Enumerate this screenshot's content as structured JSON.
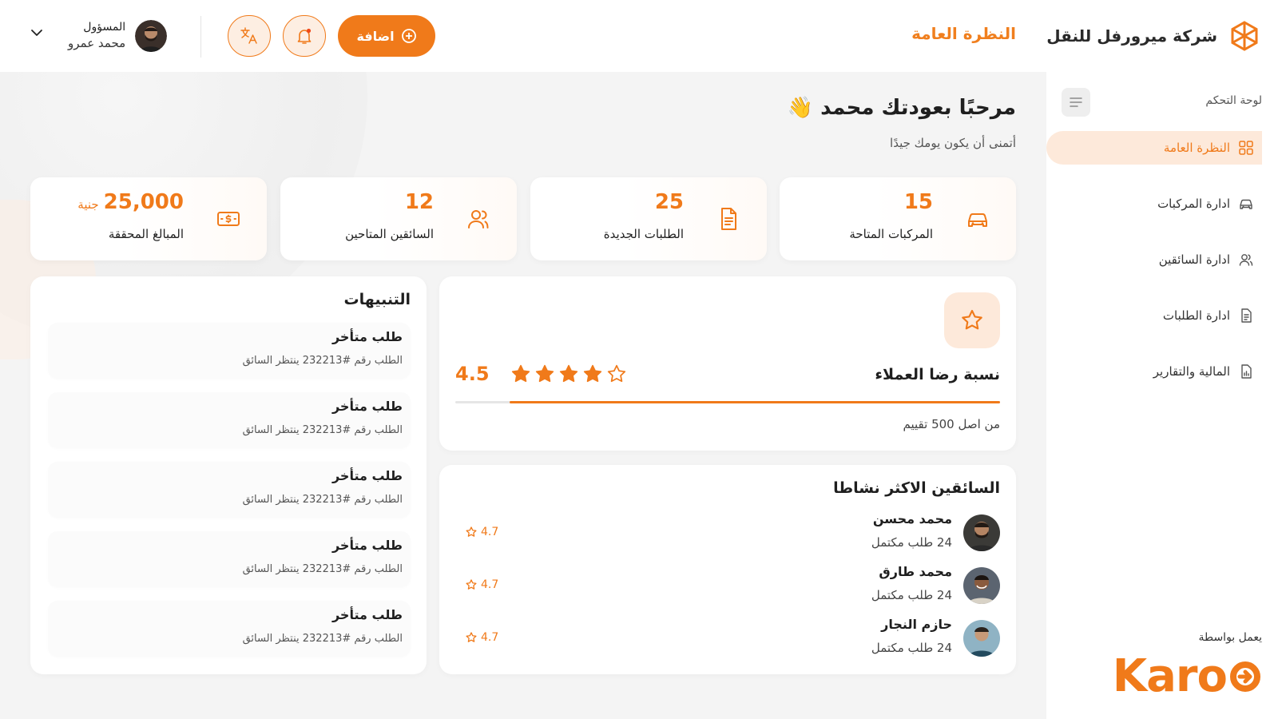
{
  "header": {
    "company_name": "شركة ميرورفل للنقل",
    "page_title": "النظرة العامة",
    "add_button": "اضافة",
    "user_role": "المسؤول",
    "user_name": "محمد عمرو"
  },
  "sidebar": {
    "section_label": "لوحة التحكم",
    "items": [
      {
        "label": "النظرة العامة",
        "icon": "grid-icon",
        "active": true
      },
      {
        "label": "ادارة المركبات",
        "icon": "car-icon",
        "active": false
      },
      {
        "label": "ادارة السائقين",
        "icon": "users-icon",
        "active": false
      },
      {
        "label": "ادارة الطلبات",
        "icon": "document-icon",
        "active": false
      },
      {
        "label": "المالية والتقارير",
        "icon": "report-icon",
        "active": false
      }
    ],
    "powered_by": "يعمل بواسطة",
    "powered_brand": "Karo"
  },
  "welcome": {
    "title": "مرحبًا بعودتك محمد 👋",
    "subtitle": "أتمنى أن يكون يومك جيدًا"
  },
  "stats": [
    {
      "value": "15",
      "label": "المركبات المتاحة",
      "icon": "car-icon"
    },
    {
      "value": "25",
      "label": "الطلبات الجديدة",
      "icon": "document-icon"
    },
    {
      "value": "12",
      "label": "السائقين المتاحين",
      "icon": "users-icon"
    },
    {
      "value": "25,000",
      "unit": "جنية",
      "label": "المبالغ المحققة",
      "icon": "money-icon"
    }
  ],
  "rating": {
    "title": "نسبة رضا العملاء",
    "score": "4.5",
    "score_fraction": 0.9,
    "stars_filled": 4,
    "stars_total": 5,
    "subtitle": "من اصل 500 تقييم"
  },
  "top_drivers": {
    "title": "السائقين الاكثر نشاطا",
    "items": [
      {
        "name": "محمد محسن",
        "orders": "24 طلب مكتمل",
        "rating": "4.7"
      },
      {
        "name": "محمد طارق",
        "orders": "24 طلب مكتمل",
        "rating": "4.7"
      },
      {
        "name": "حازم النجار",
        "orders": "24 طلب مكتمل",
        "rating": "4.7"
      }
    ]
  },
  "alerts": {
    "title": "التنبيهات",
    "items": [
      {
        "title": "طلب متأخر",
        "text": "الطلب رقم #232213 ينتظر السائق"
      },
      {
        "title": "طلب متأخر",
        "text": "الطلب رقم #232213 ينتظر السائق"
      },
      {
        "title": "طلب متأخر",
        "text": "الطلب رقم #232213 ينتظر السائق"
      },
      {
        "title": "طلب متأخر",
        "text": "الطلب رقم #232213 ينتظر السائق"
      },
      {
        "title": "طلب متأخر",
        "text": "الطلب رقم #232213 ينتظر السائق"
      }
    ]
  },
  "colors": {
    "accent": "#f07a1a",
    "accent_light": "#fde9da"
  }
}
